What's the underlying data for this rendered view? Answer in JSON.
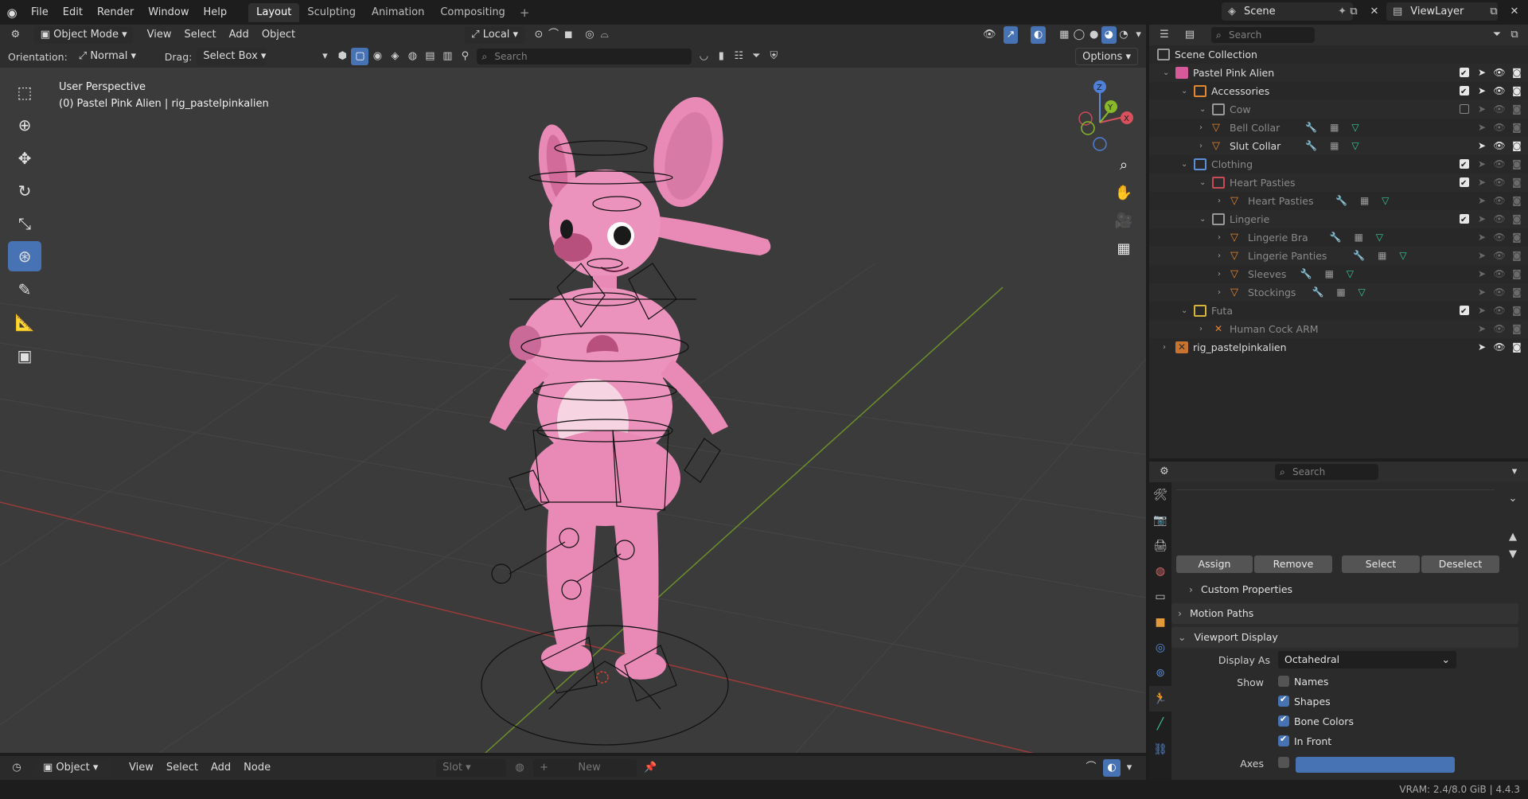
{
  "menu": [
    "File",
    "Edit",
    "Render",
    "Window",
    "Help"
  ],
  "workspaces": [
    "Layout",
    "Sculpting",
    "Animation",
    "Compositing"
  ],
  "active_workspace": "Layout",
  "scene_name": "Scene",
  "view_layer": "ViewLayer",
  "viewport": {
    "mode": "Object Mode",
    "menus": [
      "View",
      "Select",
      "Add",
      "Object"
    ],
    "transform_space": "Local",
    "orientation_label": "Orientation:",
    "orientation_value": "Normal",
    "drag_label": "Drag:",
    "drag_value": "Select Box",
    "search_placeholder": "Search",
    "options_label": "Options",
    "info_line1": "User Perspective",
    "info_line2": "(0) Pastel Pink Alien | rig_pastelpinkalien",
    "gizmo_axes": {
      "x": "X",
      "y": "Y",
      "z": "Z"
    }
  },
  "bottom_editor": {
    "mode": "Object",
    "menus": [
      "View",
      "Select",
      "Add",
      "Node"
    ],
    "slot_label": "Slot",
    "new_label": "New"
  },
  "outliner": {
    "search_placeholder": "Search",
    "rows": [
      {
        "label": "Scene Collection",
        "depth": 0,
        "kind": "scene",
        "dim": false
      },
      {
        "label": "Pastel Pink Alien",
        "depth": 1,
        "kind": "collection-pink",
        "dim": false
      },
      {
        "label": "Accessories",
        "depth": 2,
        "kind": "collection-orange",
        "dim": false
      },
      {
        "label": "Cow",
        "depth": 3,
        "kind": "collection-gray",
        "dim": true
      },
      {
        "label": "Bell Collar",
        "depth": 3,
        "kind": "mesh",
        "dim": true
      },
      {
        "label": "Slut Collar",
        "depth": 3,
        "kind": "mesh",
        "dim": false
      },
      {
        "label": "Clothing",
        "depth": 2,
        "kind": "collection-blue",
        "dim": true
      },
      {
        "label": "Heart Pasties",
        "depth": 3,
        "kind": "collection-red",
        "dim": true
      },
      {
        "label": "Heart Pasties",
        "depth": 4,
        "kind": "mesh",
        "dim": true
      },
      {
        "label": "Lingerie",
        "depth": 3,
        "kind": "collection-gray",
        "dim": true
      },
      {
        "label": "Lingerie Bra",
        "depth": 4,
        "kind": "mesh",
        "dim": true
      },
      {
        "label": "Lingerie Panties",
        "depth": 4,
        "kind": "mesh",
        "dim": true
      },
      {
        "label": "Sleeves",
        "depth": 4,
        "kind": "mesh",
        "dim": true
      },
      {
        "label": "Stockings",
        "depth": 4,
        "kind": "mesh",
        "dim": true
      },
      {
        "label": "Futa",
        "depth": 2,
        "kind": "collection-yellow",
        "dim": true
      },
      {
        "label": "Human Cock ARM",
        "depth": 3,
        "kind": "armature",
        "dim": true
      },
      {
        "label": "rig_pastelpinkalien",
        "depth": 1,
        "kind": "armature",
        "dim": false
      }
    ]
  },
  "properties": {
    "search_placeholder": "Search",
    "buttons": [
      "Assign",
      "Remove",
      "Select",
      "Deselect"
    ],
    "panels": {
      "custom_properties": "Custom Properties",
      "motion_paths": "Motion Paths",
      "viewport_display": "Viewport Display"
    },
    "display_as_label": "Display As",
    "display_as_value": "Octahedral",
    "show_label": "Show",
    "show_options": [
      {
        "label": "Names",
        "checked": false
      },
      {
        "label": "Shapes",
        "checked": true
      },
      {
        "label": "Bone Colors",
        "checked": true
      },
      {
        "label": "In Front",
        "checked": true
      }
    ],
    "axes_label": "Axes"
  },
  "status": {
    "vram": "VRAM: 2.4/8.0 GiB | 4.4.3"
  },
  "colors": {
    "accent": "#4772b3",
    "model_pink": "#e889b6",
    "grid_red": "#9a3b3b",
    "grid_green": "#6b8f2a"
  }
}
